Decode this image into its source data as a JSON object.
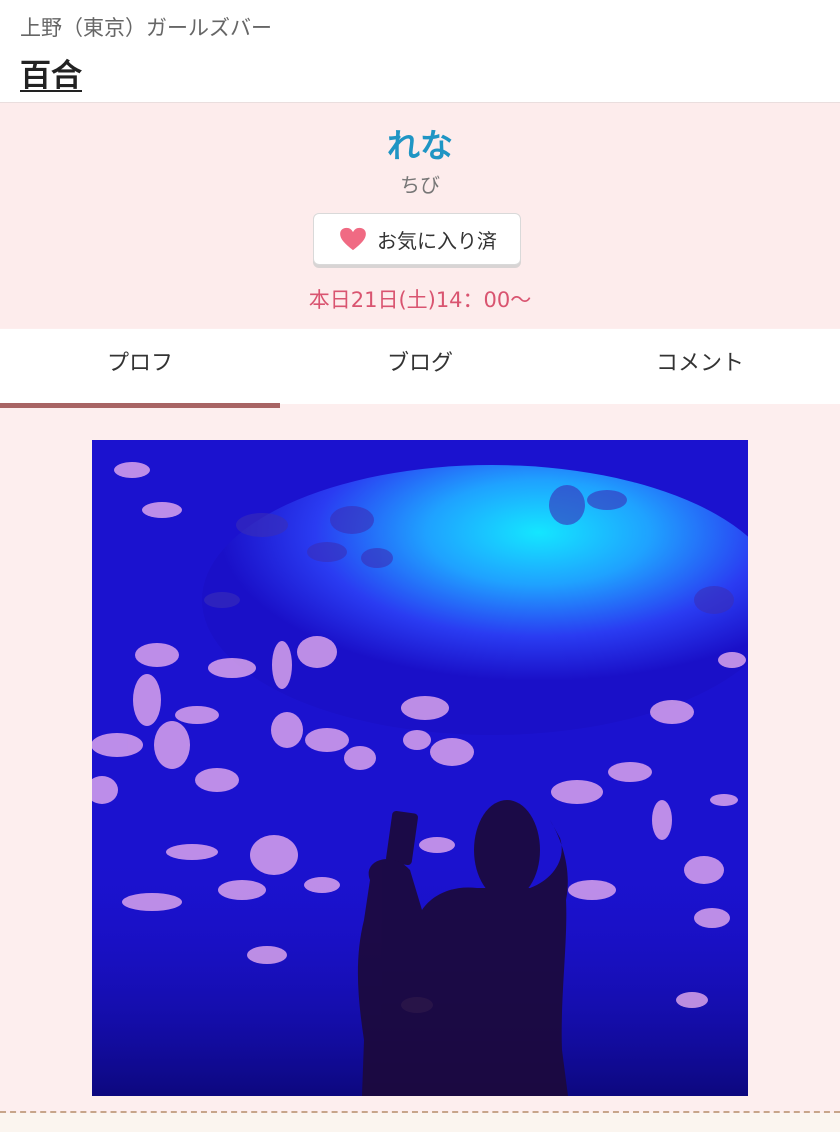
{
  "header": {
    "area": "上野（東京）ガールズバー",
    "shop_name": "百合"
  },
  "profile": {
    "name": "れな",
    "type": "ちび",
    "favorite_button": {
      "label": "お気に入り済",
      "icon": "heart-icon",
      "color": "#f06a83"
    },
    "schedule": "本日21日(土)14：00〜"
  },
  "tabs": [
    {
      "label": "プロフ",
      "active": true
    },
    {
      "label": "ブログ",
      "active": false
    },
    {
      "label": "コメント",
      "active": false
    }
  ],
  "colors": {
    "accent_name": "#1f95c4",
    "schedule": "#d95470",
    "tab_indicator": "#a86464",
    "background": "#fdeeee"
  },
  "photo": {
    "subject": "silhouette-photographing-jellyfish-aquarium"
  }
}
